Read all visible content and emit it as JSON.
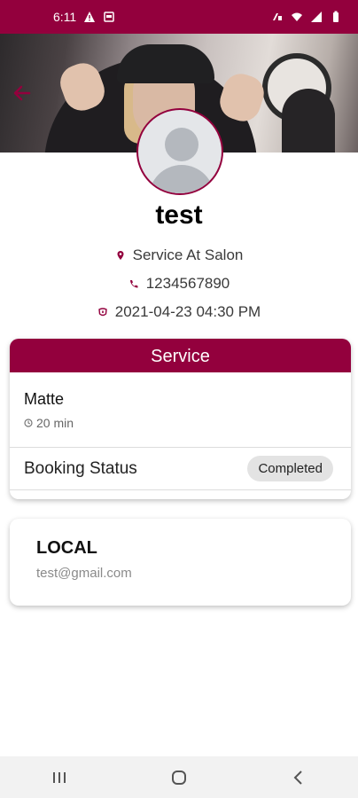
{
  "status_bar": {
    "time": "6:11",
    "icons": [
      "warning-icon",
      "card-icon",
      "volte-icon",
      "wifi-icon",
      "signal-icon",
      "battery-icon"
    ]
  },
  "header": {
    "back_icon": "arrow-left-icon"
  },
  "profile": {
    "name": "test",
    "location": "Service At Salon",
    "phone": "1234567890",
    "datetime": "2021-04-23 04:30 PM"
  },
  "service_card": {
    "title": "Service",
    "item_name": "Matte",
    "duration": "20 min",
    "status_label": "Booking Status",
    "status_value": "Completed"
  },
  "user_card": {
    "name": "LOCAL",
    "email": "test@gmail.com"
  },
  "nav": {
    "recents_icon": "recents-icon",
    "home_icon": "home-icon",
    "back_icon": "back-icon"
  },
  "colors": {
    "brand": "#93003d",
    "badge_bg": "#e3e3e3"
  }
}
